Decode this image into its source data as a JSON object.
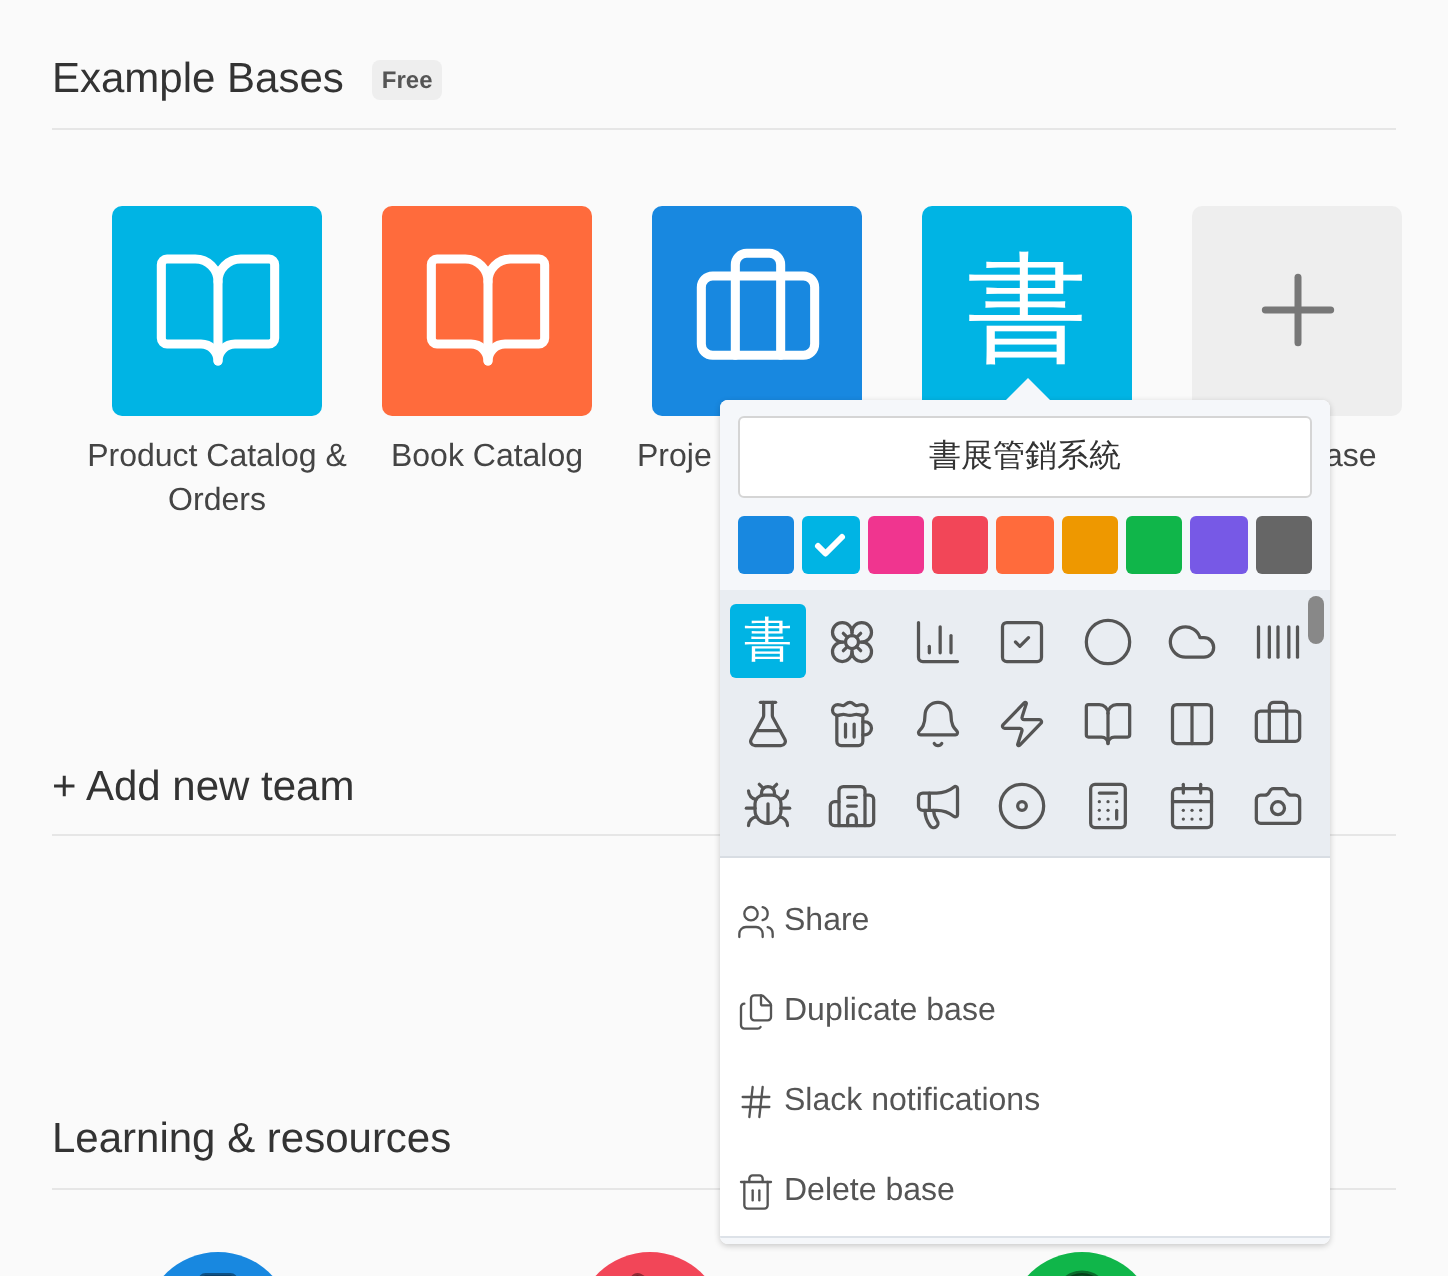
{
  "example_bases": {
    "title": "Example Bases",
    "badge": "Free",
    "tiles": [
      {
        "kind": "book",
        "color": "#00b4e4",
        "label": "Product Catalog & Orders"
      },
      {
        "kind": "book",
        "color": "#ff6b3c",
        "label": "Book Catalog"
      },
      {
        "kind": "briefcase",
        "color": "#1888e0",
        "label": "Proje"
      },
      {
        "kind": "glyph",
        "color": "#00b4e4",
        "glyph": "書"
      },
      {
        "kind": "add",
        "color": "#eeeeee",
        "label": "ase"
      }
    ]
  },
  "add_team": {
    "label": "+ Add new team"
  },
  "learning": {
    "title": "Learning & resources",
    "items": [
      {
        "color": "#1888e0"
      },
      {
        "color": "#f24658"
      },
      {
        "color": "#10b64a"
      }
    ]
  },
  "popover": {
    "name": "書展管銷系統",
    "colors": [
      {
        "color": "#1888e0",
        "selected": false
      },
      {
        "color": "#00b4e4",
        "selected": true
      },
      {
        "color": "#f0358f",
        "selected": false
      },
      {
        "color": "#f24658",
        "selected": false
      },
      {
        "color": "#ff6b3c",
        "selected": false
      },
      {
        "color": "#ee9800",
        "selected": false
      },
      {
        "color": "#10b64a",
        "selected": false
      },
      {
        "color": "#7759e6",
        "selected": false
      },
      {
        "color": "#666666",
        "selected": false
      }
    ],
    "icons": [
      {
        "glyph": "書",
        "selected": true
      },
      {
        "selected": false
      },
      {
        "selected": false
      },
      {
        "selected": false
      },
      {
        "selected": false
      },
      {
        "selected": false
      },
      {
        "selected": false
      },
      {
        "selected": false
      },
      {
        "selected": false
      },
      {
        "selected": false
      },
      {
        "selected": false
      },
      {
        "selected": false
      },
      {
        "selected": false
      },
      {
        "selected": false
      },
      {
        "selected": false
      },
      {
        "selected": false
      },
      {
        "selected": false
      },
      {
        "selected": false
      },
      {
        "selected": false
      },
      {
        "selected": false
      },
      {
        "selected": false
      }
    ],
    "menu": [
      {
        "label": "Share"
      },
      {
        "label": "Duplicate base"
      },
      {
        "label": "Slack notifications"
      },
      {
        "label": "Delete base"
      }
    ]
  }
}
